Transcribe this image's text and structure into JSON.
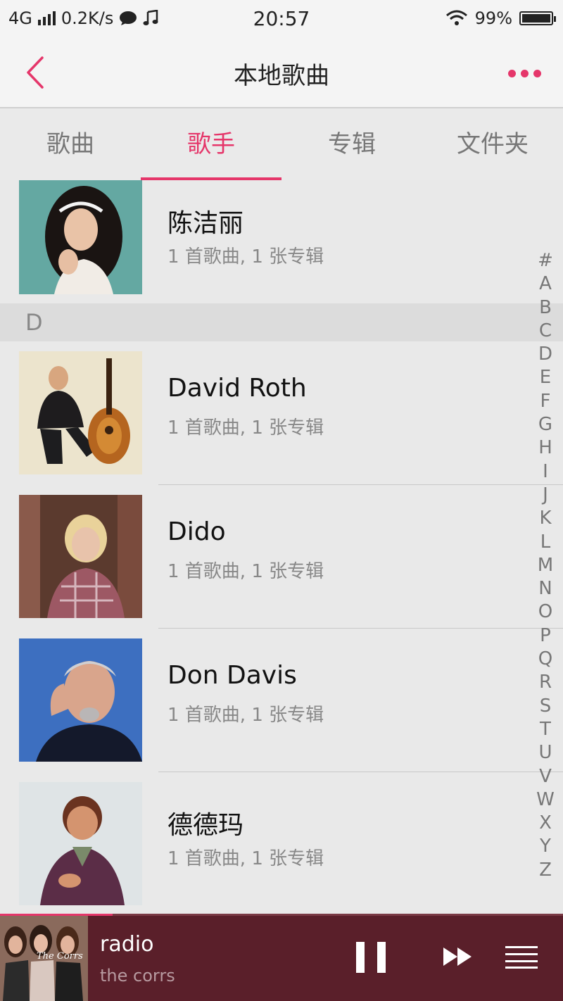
{
  "status_bar": {
    "network": "4G",
    "speed": "0.2K/s",
    "time": "20:57",
    "battery_percent": "99%",
    "battery_level": 0.99
  },
  "header": {
    "title": "本地歌曲"
  },
  "tabs": [
    {
      "label": "歌曲",
      "active": false
    },
    {
      "label": "歌手",
      "active": true
    },
    {
      "label": "专辑",
      "active": false
    },
    {
      "label": "文件夹",
      "active": false
    }
  ],
  "artists": [
    {
      "name": "陈洁丽",
      "meta": "1 首歌曲, 1 张专辑"
    },
    {
      "name": "David Roth",
      "meta": "1 首歌曲, 1 张专辑"
    },
    {
      "name": "Dido",
      "meta": "1 首歌曲, 1 张专辑"
    },
    {
      "name": "Don Davis",
      "meta": "1 首歌曲, 1 张专辑"
    },
    {
      "name": "德德玛",
      "meta": "1 首歌曲, 1 张专辑"
    }
  ],
  "section_header": "D",
  "alphabet": [
    "#",
    "A",
    "B",
    "C",
    "D",
    "E",
    "F",
    "G",
    "H",
    "I",
    "J",
    "K",
    "L",
    "M",
    "N",
    "O",
    "P",
    "Q",
    "R",
    "S",
    "T",
    "U",
    "V",
    "W",
    "X",
    "Y",
    "Z"
  ],
  "player": {
    "song": "radio",
    "artist": "the corrs",
    "cover_text": "The Corrs",
    "progress": 0.2
  },
  "colors": {
    "accent": "#e5366a",
    "player_bg": "#5a1f2a"
  }
}
